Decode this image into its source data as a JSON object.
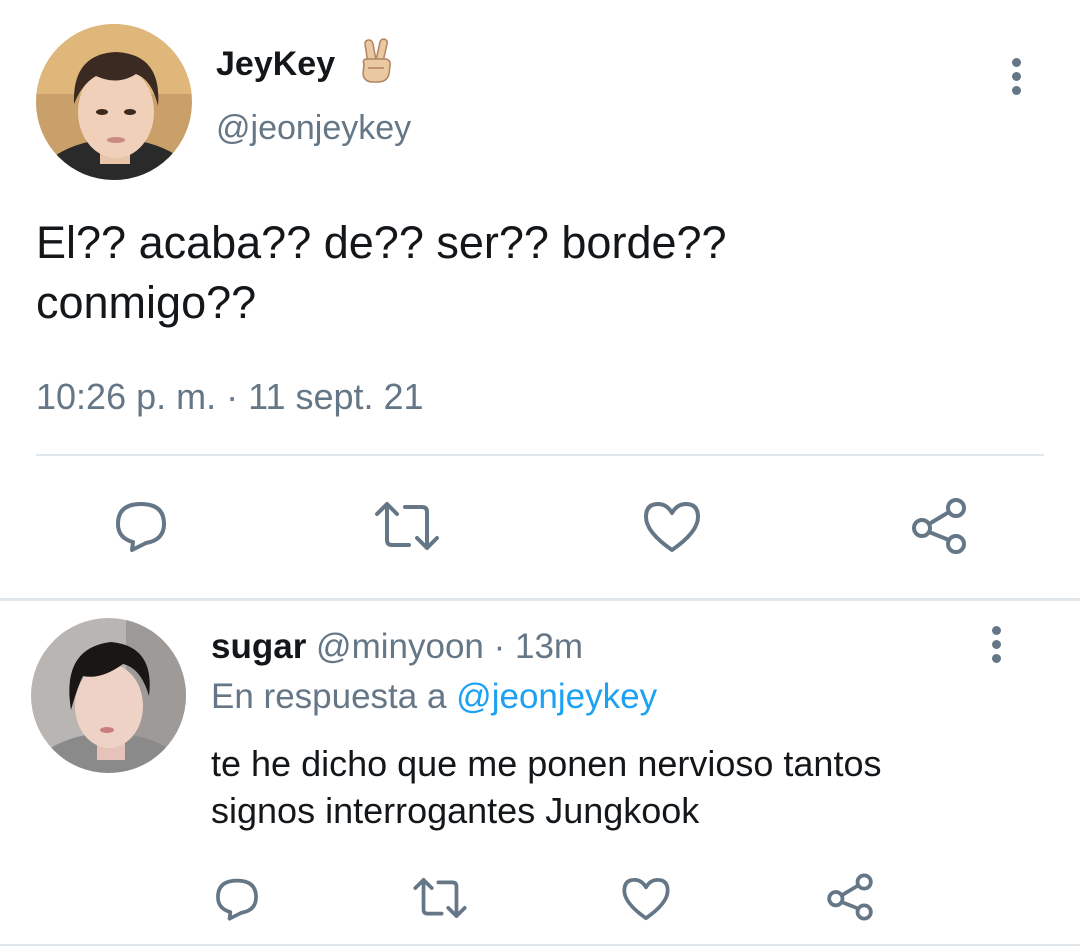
{
  "main_tweet": {
    "display_name": "JeyKey",
    "name_emoji": "✌",
    "handle": "@jeonjeykey",
    "text_line1": "El?? acaba?? de?? ser?? borde??",
    "text_line2": "conmigo??",
    "timestamp": "10:26 p. m. · 11 sept. 21",
    "icons": [
      "reply-icon",
      "retweet-icon",
      "like-icon",
      "share-icon"
    ]
  },
  "reply_tweet": {
    "display_name": "sugar",
    "handle": "@minyoon",
    "time": "· 13m",
    "reply_prefix": "En respuesta a",
    "reply_to": "@jeonjeykey",
    "text_line1": "te he dicho que me ponen nervioso tantos",
    "text_line2": "signos interrogantes Jungkook",
    "icons": [
      "reply-icon",
      "retweet-icon",
      "like-icon",
      "share-icon"
    ]
  },
  "colors": {
    "text": "#14171a",
    "secondary": "#657786",
    "link": "#1da1f2",
    "divider": "#e1e8ed",
    "emoji_skin": "#e8c49a"
  }
}
